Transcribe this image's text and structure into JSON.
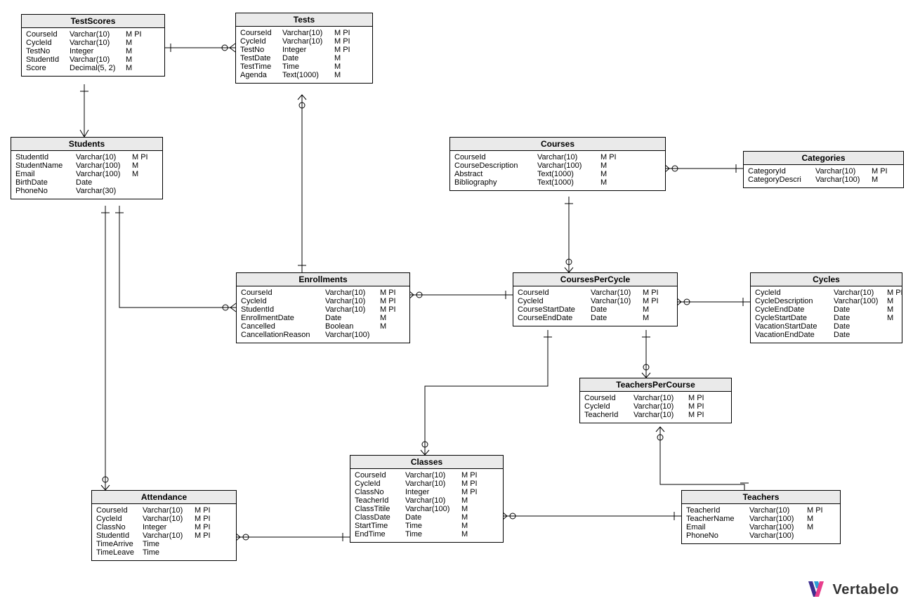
{
  "logo": {
    "text": "Vertabelo"
  },
  "entities": {
    "TestScores": {
      "title": "TestScores",
      "cols": [
        {
          "name": "CourseId",
          "type": "Varchar(10)",
          "flags": "M PI"
        },
        {
          "name": "CycleId",
          "type": "Varchar(10)",
          "flags": "M"
        },
        {
          "name": "TestNo",
          "type": "Integer",
          "flags": "M"
        },
        {
          "name": "StudentId",
          "type": "Varchar(10)",
          "flags": "M"
        },
        {
          "name": "Score",
          "type": "Decimal(5, 2)",
          "flags": "M"
        }
      ]
    },
    "Tests": {
      "title": "Tests",
      "cols": [
        {
          "name": "CourseId",
          "type": "Varchar(10)",
          "flags": "M PI"
        },
        {
          "name": "CycleId",
          "type": "Varchar(10)",
          "flags": "M PI"
        },
        {
          "name": "TestNo",
          "type": "Integer",
          "flags": "M PI"
        },
        {
          "name": "TestDate",
          "type": "Date",
          "flags": "M"
        },
        {
          "name": "TestTime",
          "type": "Time",
          "flags": "M"
        },
        {
          "name": "Agenda",
          "type": "Text(1000)",
          "flags": "M"
        }
      ]
    },
    "Students": {
      "title": "Students",
      "cols": [
        {
          "name": "StudentId",
          "type": "Varchar(10)",
          "flags": "M PI"
        },
        {
          "name": "StudentName",
          "type": "Varchar(100)",
          "flags": "M"
        },
        {
          "name": "Email",
          "type": "Varchar(100)",
          "flags": "M"
        },
        {
          "name": "BirthDate",
          "type": "Date",
          "flags": ""
        },
        {
          "name": "PhoneNo",
          "type": "Varchar(30)",
          "flags": ""
        }
      ]
    },
    "Courses": {
      "title": "Courses",
      "cols": [
        {
          "name": "CourseId",
          "type": "Varchar(10)",
          "flags": "M PI"
        },
        {
          "name": "CourseDescription",
          "type": "Varchar(100)",
          "flags": "M"
        },
        {
          "name": "Abstract",
          "type": "Text(1000)",
          "flags": "M"
        },
        {
          "name": "Bibliography",
          "type": "Text(1000)",
          "flags": "M"
        }
      ]
    },
    "Categories": {
      "title": "Categories",
      "cols": [
        {
          "name": "CategoryId",
          "type": "Varchar(10)",
          "flags": "M PI"
        },
        {
          "name": "CategoryDescri",
          "type": "Varchar(100)",
          "flags": "M"
        }
      ]
    },
    "Enrollments": {
      "title": "Enrollments",
      "cols": [
        {
          "name": "CourseId",
          "type": "Varchar(10)",
          "flags": "M PI"
        },
        {
          "name": "CycleId",
          "type": "Varchar(10)",
          "flags": "M PI"
        },
        {
          "name": "StudentId",
          "type": "Varchar(10)",
          "flags": "M PI"
        },
        {
          "name": "EnrollmentDate",
          "type": "Date",
          "flags": "M"
        },
        {
          "name": "Cancelled",
          "type": "Boolean",
          "flags": "M"
        },
        {
          "name": "CancellationReason",
          "type": "Varchar(100)",
          "flags": ""
        }
      ]
    },
    "CoursesPerCycle": {
      "title": "CoursesPerCycle",
      "cols": [
        {
          "name": "CourseId",
          "type": "Varchar(10)",
          "flags": "M PI"
        },
        {
          "name": "CycleId",
          "type": "Varchar(10)",
          "flags": "M PI"
        },
        {
          "name": "CourseStartDate",
          "type": "Date",
          "flags": "M"
        },
        {
          "name": "CourseEndDate",
          "type": "Date",
          "flags": "M"
        }
      ]
    },
    "Cycles": {
      "title": "Cycles",
      "cols": [
        {
          "name": "CycleId",
          "type": "Varchar(10)",
          "flags": "M PI"
        },
        {
          "name": "CycleDescription",
          "type": "Varchar(100)",
          "flags": "M"
        },
        {
          "name": "CycleEndDate",
          "type": "Date",
          "flags": "M"
        },
        {
          "name": "CycleStartDate",
          "type": "Date",
          "flags": "M"
        },
        {
          "name": "VacationStartDate",
          "type": "Date",
          "flags": ""
        },
        {
          "name": "VacationEndDate",
          "type": "Date",
          "flags": ""
        }
      ]
    },
    "TeachersPerCourse": {
      "title": "TeachersPerCourse",
      "cols": [
        {
          "name": "CourseId",
          "type": "Varchar(10)",
          "flags": "M PI"
        },
        {
          "name": "CycleId",
          "type": "Varchar(10)",
          "flags": "M PI"
        },
        {
          "name": "TeacherId",
          "type": "Varchar(10)",
          "flags": "M PI"
        }
      ]
    },
    "Classes": {
      "title": "Classes",
      "cols": [
        {
          "name": "CourseId",
          "type": "Varchar(10)",
          "flags": "M PI"
        },
        {
          "name": "CycleId",
          "type": "Varchar(10)",
          "flags": "M PI"
        },
        {
          "name": "ClassNo",
          "type": "Integer",
          "flags": "M PI"
        },
        {
          "name": "TeacherId",
          "type": "Varchar(10)",
          "flags": "M"
        },
        {
          "name": "ClassTitile",
          "type": "Varchar(100)",
          "flags": "M"
        },
        {
          "name": "ClassDate",
          "type": "Date",
          "flags": "M"
        },
        {
          "name": "StartTime",
          "type": "Time",
          "flags": "M"
        },
        {
          "name": "EndTime",
          "type": "Time",
          "flags": "M"
        }
      ]
    },
    "Attendance": {
      "title": "Attendance",
      "cols": [
        {
          "name": "CourseId",
          "type": "Varchar(10)",
          "flags": "M PI"
        },
        {
          "name": "CycleId",
          "type": "Varchar(10)",
          "flags": "M PI"
        },
        {
          "name": "ClassNo",
          "type": "Integer",
          "flags": "M PI"
        },
        {
          "name": "StudentId",
          "type": "Varchar(10)",
          "flags": "M PI"
        },
        {
          "name": "TimeArrive",
          "type": "Time",
          "flags": ""
        },
        {
          "name": "TimeLeave",
          "type": "Time",
          "flags": ""
        }
      ]
    },
    "Teachers": {
      "title": "Teachers",
      "cols": [
        {
          "name": "TeacherId",
          "type": "Varchar(10)",
          "flags": "M PI"
        },
        {
          "name": "TeacherName",
          "type": "Varchar(100)",
          "flags": "M"
        },
        {
          "name": "Email",
          "type": "Varchar(100)",
          "flags": "M"
        },
        {
          "name": "PhoneNo",
          "type": "Varchar(100)",
          "flags": ""
        }
      ]
    }
  }
}
